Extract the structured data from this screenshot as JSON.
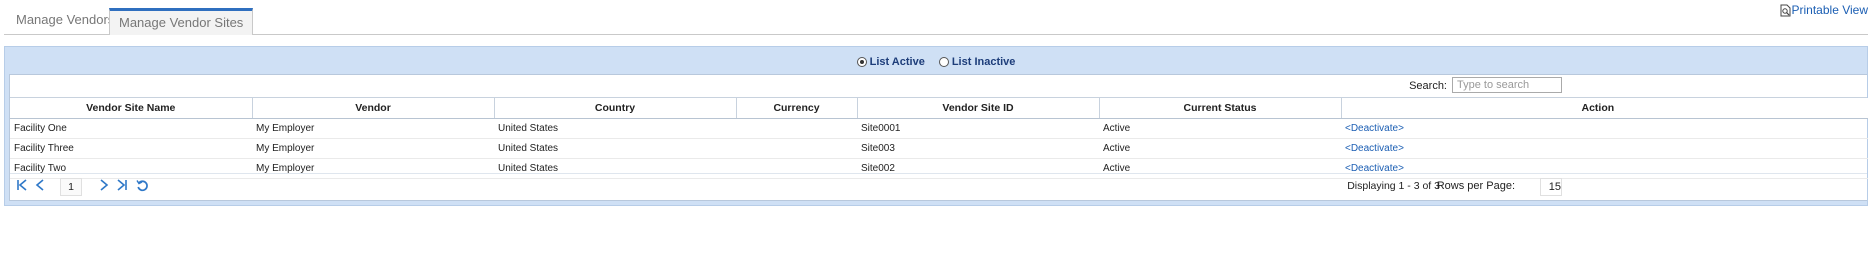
{
  "tabs": [
    {
      "label": "Manage Vendors"
    },
    {
      "label": "Manage Vendor Sites"
    }
  ],
  "printable_view": "Printable View",
  "filter": {
    "list_active": "List Active",
    "list_inactive": "List Inactive",
    "selected": "List Active"
  },
  "search": {
    "label": "Search:",
    "placeholder": "Type to search"
  },
  "table": {
    "columns": [
      "Vendor Site Name",
      "Vendor",
      "Country",
      "Currency",
      "Vendor Site ID",
      "Current Status",
      "Action"
    ],
    "rows": [
      {
        "site_name": "Facility One",
        "vendor": "My Employer",
        "country": "United States",
        "currency": "",
        "site_id": "Site0001",
        "status": "Active",
        "action": "<Deactivate>"
      },
      {
        "site_name": "Facility Three",
        "vendor": "My Employer",
        "country": "United States",
        "currency": "",
        "site_id": "Site003",
        "status": "Active",
        "action": "<Deactivate>"
      },
      {
        "site_name": "Facility Two",
        "vendor": "My Employer",
        "country": "United States",
        "currency": "",
        "site_id": "Site002",
        "status": "Active",
        "action": "<Deactivate>"
      }
    ]
  },
  "pager": {
    "page": "1",
    "displaying": "Displaying 1 - 3 of 3",
    "rows_per_page_label": "Rows per Page:",
    "rows_per_page": "15"
  },
  "colors": {
    "panel_bg": "#cfe0f5",
    "accent": "#2f6fbf",
    "link": "#1b5eb3"
  }
}
